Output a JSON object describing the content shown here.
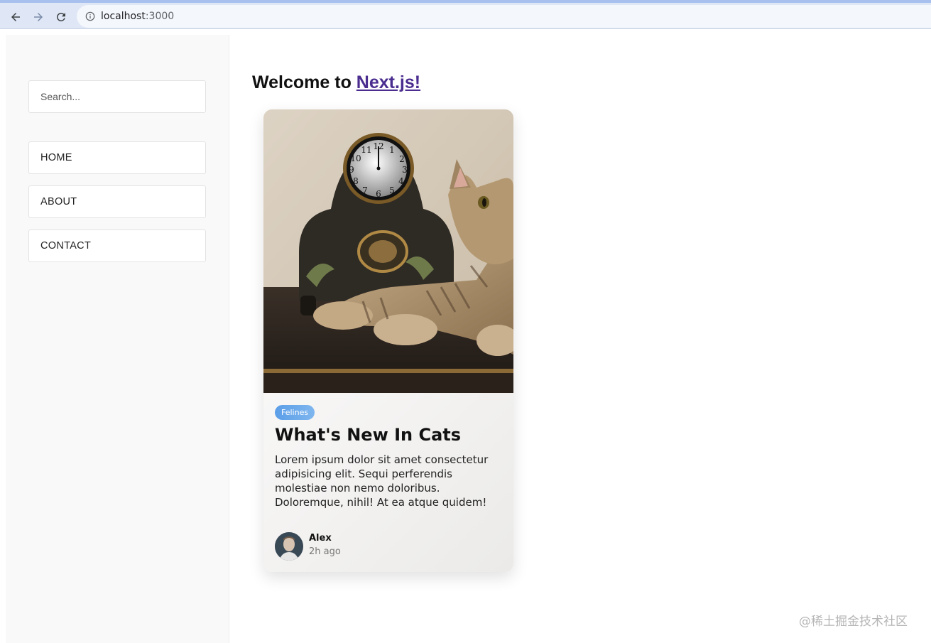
{
  "browser": {
    "url_host": "localhost",
    "url_port": ":3000",
    "back_icon": "arrow-left-icon",
    "forward_icon": "arrow-right-icon",
    "reload_icon": "reload-icon",
    "info_icon": "info-icon"
  },
  "sidebar": {
    "search_placeholder": "Search...",
    "items": [
      {
        "label": "HOME"
      },
      {
        "label": "ABOUT"
      },
      {
        "label": "CONTACT"
      }
    ]
  },
  "main": {
    "heading_prefix": "Welcome to ",
    "heading_link": "Next.js!"
  },
  "card": {
    "tag": "Felines",
    "title": "What's New In Cats",
    "text": "Lorem ipsum dolor sit amet consectetur adipisicing elit. Sequi perferendis molestiae non nemo doloribus. Doloremque, nihil! At ea atque quidem!",
    "author": "Alex",
    "time": "2h ago",
    "clock_numbers": [
      "12",
      "1",
      "2",
      "3",
      "4",
      "5",
      "6",
      "7",
      "8",
      "9",
      "10",
      "11"
    ]
  },
  "watermark": "@稀土掘金技术社区",
  "colors": {
    "link": "#4a2d8f",
    "tag_start": "#5b9ee8",
    "tag_end": "#7fb6ee"
  }
}
